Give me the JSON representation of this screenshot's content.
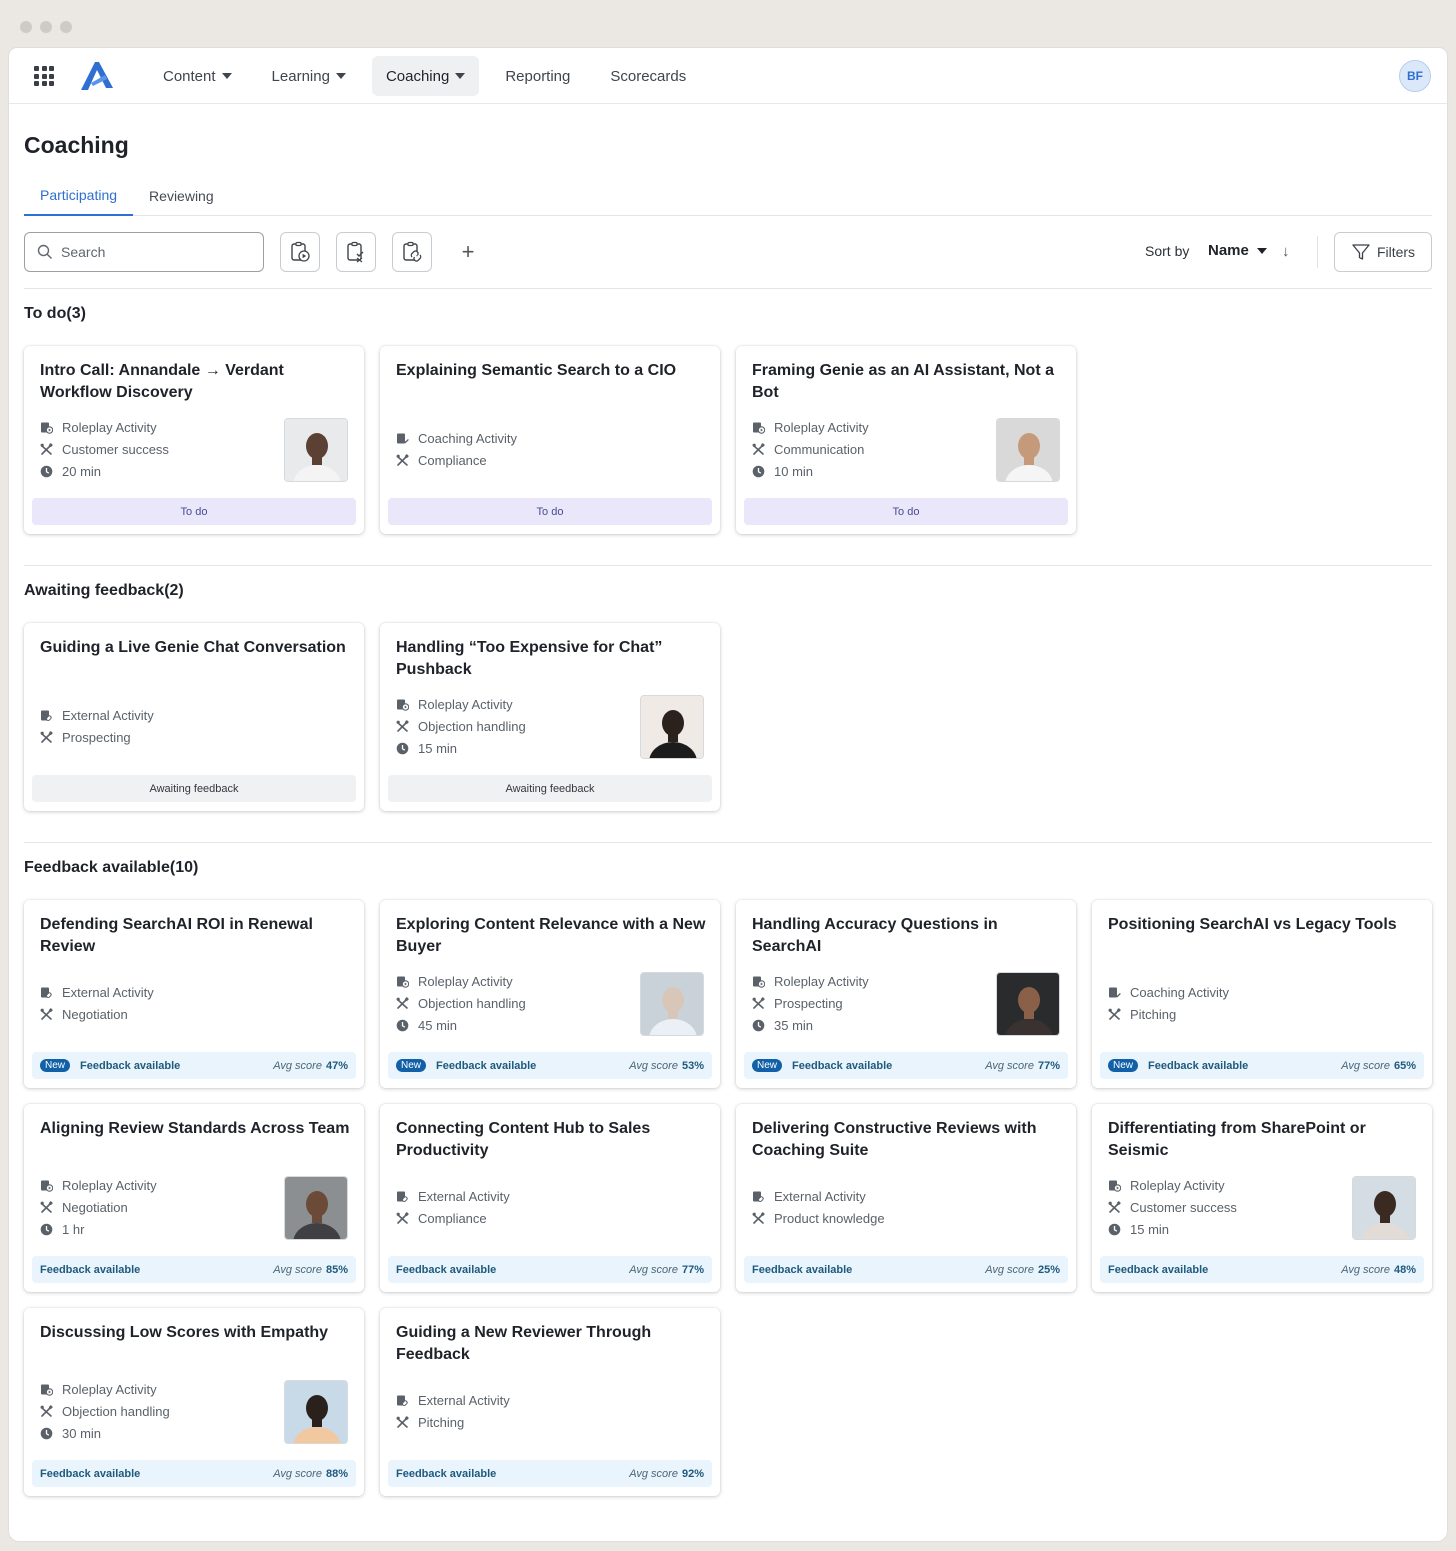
{
  "nav": {
    "items": [
      {
        "label": "Content",
        "dropdown": true,
        "active": false
      },
      {
        "label": "Learning",
        "dropdown": true,
        "active": false
      },
      {
        "label": "Coaching",
        "dropdown": true,
        "active": true
      },
      {
        "label": "Reporting",
        "dropdown": false,
        "active": false
      },
      {
        "label": "Scorecards",
        "dropdown": false,
        "active": false
      }
    ],
    "user_initials": "BF"
  },
  "page": {
    "title": "Coaching",
    "tabs": [
      {
        "label": "Participating",
        "active": true
      },
      {
        "label": "Reviewing",
        "active": false
      }
    ]
  },
  "toolbar": {
    "search_placeholder": "Search",
    "plus": "+",
    "sort_label": "Sort by",
    "sort_value": "Name",
    "sort_direction": "↓",
    "filters_label": "Filters"
  },
  "colors": {
    "accent": "#2f6fd1",
    "todo_bg": "#ebe7fb",
    "feedback_bg": "#e9f4fc",
    "new_badge": "#1260a8"
  },
  "sections": [
    {
      "title": "To do",
      "count": "(3)",
      "cards": [
        {
          "title": "Intro Call: Annandale → Verdant Workflow Discovery",
          "type": "Roleplay Activity",
          "skill": "Customer success",
          "duration": "20 min",
          "thumb": "man-smiling",
          "status": "To do",
          "status_kind": "todo"
        },
        {
          "title": "Explaining Semantic Search to a CIO",
          "type": "Coaching Activity",
          "skill": "Compliance",
          "duration": "",
          "thumb": "",
          "status": "To do",
          "status_kind": "todo"
        },
        {
          "title": "Framing Genie as an AI Assistant, Not a Bot",
          "type": "Roleplay Activity",
          "skill": "Communication",
          "duration": "10 min",
          "thumb": "man-bearded",
          "status": "To do",
          "status_kind": "todo"
        }
      ]
    },
    {
      "title": "Awaiting feedback",
      "count": "(2)",
      "cards": [
        {
          "title": "Guiding a Live Genie Chat Conversation",
          "type": "External Activity",
          "skill": "Prospecting",
          "duration": "",
          "thumb": "",
          "status": "Awaiting feedback",
          "status_kind": "await"
        },
        {
          "title": "Handling “Too Expensive for Chat” Pushback",
          "type": "Roleplay Activity",
          "skill": "Objection handling",
          "duration": "15 min",
          "thumb": "woman-dark-hair",
          "status": "Awaiting feedback",
          "status_kind": "await"
        }
      ]
    },
    {
      "title": "Feedback available",
      "count": "(10)",
      "cards": [
        {
          "title": "Defending SearchAI ROI in Renewal Review",
          "type": "External Activity",
          "skill": "Negotiation",
          "duration": "",
          "thumb": "",
          "status": "Feedback available",
          "status_kind": "fb",
          "is_new": true,
          "avg_label": "Avg score",
          "avg": "47%"
        },
        {
          "title": "Exploring Content Relevance with a New Buyer",
          "type": "Roleplay Activity",
          "skill": "Objection handling",
          "duration": "45 min",
          "thumb": "woman-grey-hair",
          "status": "Feedback available",
          "status_kind": "fb",
          "is_new": true,
          "avg_label": "Avg score",
          "avg": "53%"
        },
        {
          "title": "Handling Accuracy Questions in SearchAI",
          "type": "Roleplay Activity",
          "skill": "Prospecting",
          "duration": "35 min",
          "thumb": "woman-dark-bg",
          "status": "Feedback available",
          "status_kind": "fb",
          "is_new": true,
          "avg_label": "Avg score",
          "avg": "77%"
        },
        {
          "title": "Positioning SearchAI vs Legacy Tools",
          "type": "Coaching Activity",
          "skill": "Pitching",
          "duration": "",
          "thumb": "",
          "status": "Feedback available",
          "status_kind": "fb",
          "is_new": true,
          "avg_label": "Avg score",
          "avg": "65%"
        },
        {
          "title": "Aligning Review Standards Across Team",
          "type": "Roleplay Activity",
          "skill": "Negotiation",
          "duration": "1 hr",
          "thumb": "man-suit",
          "status": "Feedback available",
          "status_kind": "fb",
          "is_new": false,
          "avg_label": "Avg score",
          "avg": "85%"
        },
        {
          "title": "Connecting Content Hub to Sales Productivity",
          "type": "External Activity",
          "skill": "Compliance",
          "duration": "",
          "thumb": "",
          "status": "Feedback available",
          "status_kind": "fb",
          "is_new": false,
          "avg_label": "Avg score",
          "avg": "77%"
        },
        {
          "title": "Delivering Constructive Reviews with Coaching Suite",
          "type": "External Activity",
          "skill": "Product knowledge",
          "duration": "",
          "thumb": "",
          "status": "Feedback available",
          "status_kind": "fb",
          "is_new": false,
          "avg_label": "Avg score",
          "avg": "25%"
        },
        {
          "title": "Differentiating from SharePoint or Seismic",
          "type": "Roleplay Activity",
          "skill": "Customer success",
          "duration": "15 min",
          "thumb": "woman-office",
          "status": "Feedback available",
          "status_kind": "fb",
          "is_new": false,
          "avg_label": "Avg score",
          "avg": "48%"
        },
        {
          "title": "Discussing Low Scores with Empathy",
          "type": "Roleplay Activity",
          "skill": "Objection handling",
          "duration": "30 min",
          "thumb": "woman-waving",
          "status": "Feedback available",
          "status_kind": "fb",
          "is_new": false,
          "avg_label": "Avg score",
          "avg": "88%"
        },
        {
          "title": "Guiding a New Reviewer Through Feedback",
          "type": "External Activity",
          "skill": "Pitching",
          "duration": "",
          "thumb": "",
          "status": "Feedback available",
          "status_kind": "fb",
          "is_new": false,
          "avg_label": "Avg score",
          "avg": "92%"
        }
      ]
    }
  ]
}
